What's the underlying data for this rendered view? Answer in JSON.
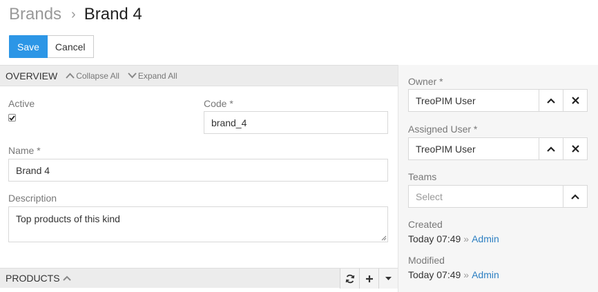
{
  "breadcrumb": {
    "parent": "Brands",
    "separator": "›",
    "current": "Brand 4"
  },
  "actions": {
    "save_label": "Save",
    "cancel_label": "Cancel"
  },
  "overview": {
    "title": "OVERVIEW",
    "collapse_all": "Collapse All",
    "expand_all": "Expand All",
    "active_label": "Active",
    "active_checked": true,
    "code_label": "Code *",
    "code_value": "brand_4",
    "name_label": "Name *",
    "name_value": "Brand 4",
    "description_label": "Description",
    "description_value": "Top products of this kind"
  },
  "products": {
    "title": "PRODUCTS"
  },
  "side": {
    "owner_label": "Owner *",
    "owner_value": "TreoPIM User",
    "assigned_label": "Assigned User *",
    "assigned_value": "TreoPIM User",
    "teams_label": "Teams",
    "teams_placeholder": "Select",
    "created_label": "Created",
    "created_time": "Today 07:49",
    "created_by": "Admin",
    "modified_label": "Modified",
    "modified_time": "Today 07:49",
    "modified_by": "Admin",
    "by_separator": "»"
  },
  "colors": {
    "primary": "#2c96e6",
    "link": "#2c7fc2",
    "panel_header": "#ececec"
  }
}
